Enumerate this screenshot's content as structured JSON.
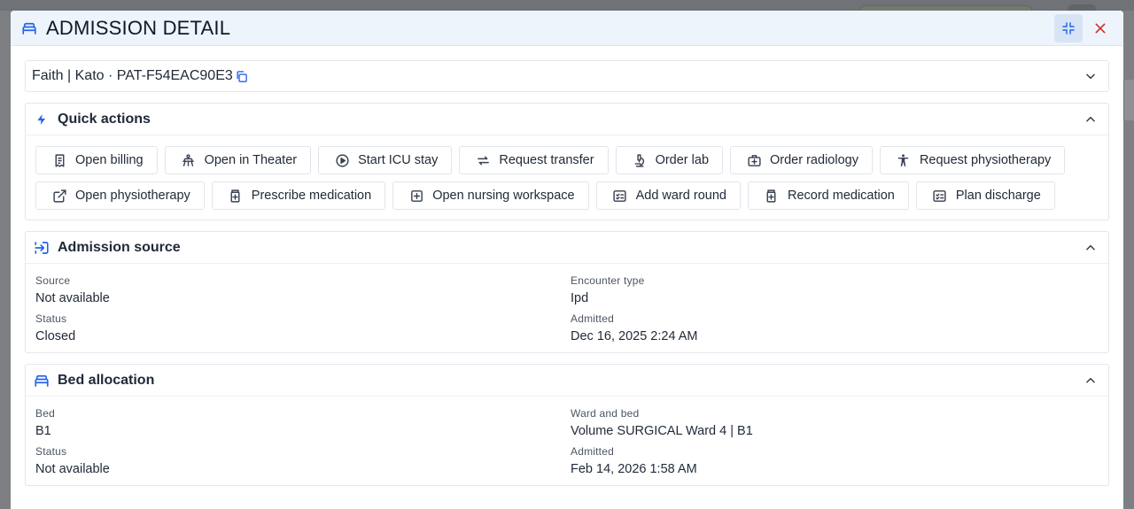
{
  "dialog": {
    "title": "ADMISSION DETAIL",
    "title_icon": "bed-icon",
    "minimize_icon": "collapse-icon",
    "close_icon": "close-icon"
  },
  "patient": {
    "summary": "Faith | Kato · PAT-F54EAC90E3",
    "copy_icon": "copy-icon"
  },
  "quick_actions": {
    "title": "Quick actions",
    "icon": "bolt-icon",
    "items": [
      {
        "label": "Open billing",
        "icon": "receipt-icon"
      },
      {
        "label": "Open in Theater",
        "icon": "surgery-icon"
      },
      {
        "label": "Start ICU stay",
        "icon": "play-circle-icon"
      },
      {
        "label": "Request transfer",
        "icon": "swap-icon"
      },
      {
        "label": "Order lab",
        "icon": "microscope-icon"
      },
      {
        "label": "Order radiology",
        "icon": "medical-kit-icon"
      },
      {
        "label": "Request physiotherapy",
        "icon": "person-icon"
      },
      {
        "label": "Open physiotherapy",
        "icon": "external-link-icon"
      },
      {
        "label": "Prescribe medication",
        "icon": "medication-icon"
      },
      {
        "label": "Open nursing workspace",
        "icon": "plus-box-icon"
      },
      {
        "label": "Add ward round",
        "icon": "checklist-icon"
      },
      {
        "label": "Record medication",
        "icon": "medication-icon"
      },
      {
        "label": "Plan discharge",
        "icon": "checklist-icon"
      }
    ]
  },
  "admission_source": {
    "title": "Admission source",
    "icon": "login-icon",
    "fields": [
      {
        "label": "Source",
        "value": "Not available"
      },
      {
        "label": "Encounter type",
        "value": "Ipd"
      },
      {
        "label": "Status",
        "value": "Closed"
      },
      {
        "label": "Admitted",
        "value": "Dec 16, 2025 2:24 AM"
      }
    ]
  },
  "bed_allocation": {
    "title": "Bed allocation",
    "icon": "bed-icon",
    "fields": [
      {
        "label": "Bed",
        "value": "B1"
      },
      {
        "label": "Ward and bed",
        "value": "Volume SURGICAL Ward 4 | B1"
      },
      {
        "label": "Status",
        "value": "Not available"
      },
      {
        "label": "Admitted",
        "value": "Feb 14, 2026 1:58 AM"
      }
    ]
  },
  "colors": {
    "accent": "#2563eb",
    "close": "#dc2626",
    "header_bg": "#eef4fb"
  }
}
